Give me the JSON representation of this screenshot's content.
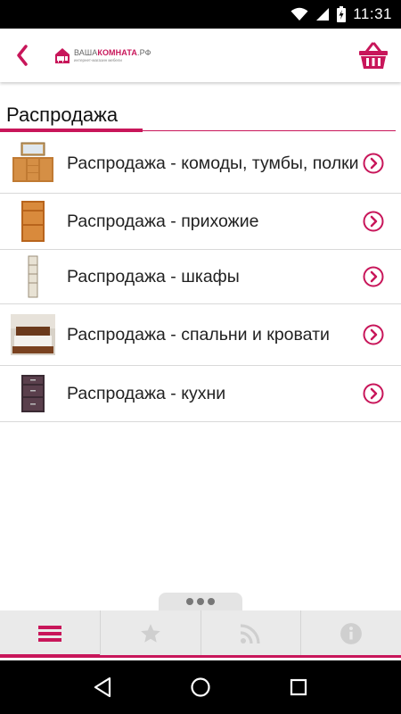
{
  "status_bar": {
    "time": "11:31",
    "icons": [
      "wifi-icon",
      "signal-icon",
      "battery-charging-icon"
    ]
  },
  "app_bar": {
    "back_icon": "chevron-left-icon",
    "logo": {
      "part1": "ВАША",
      "part2": "КОМНАТА",
      "part3": ".РФ",
      "tagline": "интернет-магазин мебели"
    },
    "cart_icon": "basket-icon"
  },
  "section": {
    "title": "Распродажа"
  },
  "items": [
    {
      "label": "Распродажа - комоды, тумбы, полки",
      "thumb": "dresser-thumb"
    },
    {
      "label": "Распродажа - прихожие",
      "thumb": "hallway-cabinet-thumb"
    },
    {
      "label": "Распродажа - шкафы",
      "thumb": "tall-cabinet-thumb"
    },
    {
      "label": "Распродажа - спальни и кровати",
      "thumb": "bedroom-thumb"
    },
    {
      "label": "Распродажа - кухни",
      "thumb": "kitchen-cabinet-thumb"
    }
  ],
  "bottom_nav": {
    "more_icon": "more-dots-icon",
    "items": [
      {
        "icon": "menu-icon",
        "active": true
      },
      {
        "icon": "star-icon",
        "active": false
      },
      {
        "icon": "rss-icon",
        "active": false
      },
      {
        "icon": "info-icon",
        "active": false
      }
    ]
  },
  "colors": {
    "accent": "#c8165a",
    "nav_background": "#eaeaea",
    "text": "#222222"
  }
}
